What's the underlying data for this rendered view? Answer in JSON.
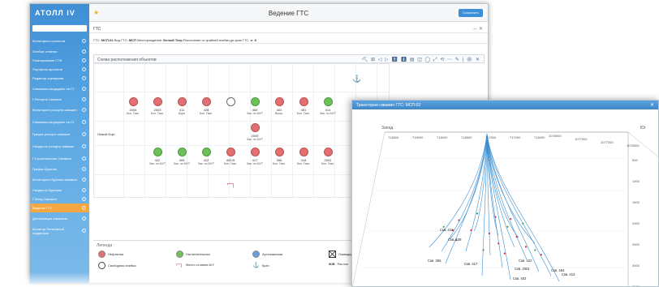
{
  "app": {
    "logo": "АТОЛЛ IV",
    "title": "Ведение ГТС",
    "save_label": "Сохранить",
    "star": "★"
  },
  "sidebar": {
    "items": [
      {
        "label": "Мониторинг проектов",
        "active": false
      },
      {
        "label": "Особые отметки",
        "active": false
      },
      {
        "label": "Планирование ГТМ",
        "active": false
      },
      {
        "label": "Портфель проектов",
        "active": false
      },
      {
        "label": "Редактор сценариев",
        "active": false
      },
      {
        "label": "Скважины-кандидаты на ГС",
        "active": false
      },
      {
        "label": "Г.Репорты Скважин",
        "active": false
      },
      {
        "label": "Мониторинг репорта скважин",
        "active": false
      },
      {
        "label": "Скважины-кандидаты на ГС",
        "active": false
      },
      {
        "label": "График репорта скважин",
        "active": false
      },
      {
        "label": "Сводка по репорту скважин",
        "active": false
      },
      {
        "label": "Г.Строительство Скважин",
        "active": false
      },
      {
        "label": "График бурения",
        "active": false
      },
      {
        "label": "Мониторинг бурения скважин",
        "active": false
      },
      {
        "label": "Сводка по бурению",
        "active": false
      },
      {
        "label": "Г.Фонд Скважин",
        "active": false
      },
      {
        "label": "Ведение ГТС",
        "active": true
      },
      {
        "label": "Детализация скважины",
        "active": false
      },
      {
        "label": "Монитор Негативной поддержки",
        "active": false
      }
    ]
  },
  "gts_bar": {
    "label": "ГТС",
    "icons": "⇔ ✕"
  },
  "info_line": {
    "gts_key": "ГТС:",
    "gts_val": "МСП-02",
    "type_key": "Вид ГТС:",
    "type_val": "МСП",
    "field_key": "Месторождение:",
    "field_val": "Белый Тигр",
    "dist_key": "Расстояние от крайней ячейки до края ГТС, м:",
    "dist_val": "8"
  },
  "panel": {
    "title": "Схема расположения объектов",
    "toolbar": "⛏ ⊞ ◁ ▷ ⬆ ⬇ ▤ ◫ ◯ ⤢ ⟲ ⋯ ✎ | ⚙ ✕"
  },
  "row_label": "Левый борт",
  "wells_top": [
    {
      "num": "2004",
      "type": "Кон. Газл.",
      "status": "red"
    },
    {
      "num": "2003",
      "type": "Кон. Газл.",
      "status": "red"
    },
    {
      "num": "411",
      "type": "Бурн",
      "status": "red"
    },
    {
      "num": "428",
      "type": "Кон. Газл.",
      "status": "red"
    },
    {
      "num": "",
      "type": "",
      "status": "empty"
    },
    {
      "num": "464",
      "type": "Зак. по МУТ",
      "status": "green"
    },
    {
      "num": "402",
      "type": "Воош.",
      "status": "red"
    },
    {
      "num": "451",
      "type": "Кон. Газл.",
      "status": "red"
    },
    {
      "num": "414",
      "type": "Зак. по МУТ",
      "status": "green"
    }
  ],
  "well_mid": {
    "num": "2005",
    "type": "Зак. по МУТ",
    "status": "red"
  },
  "wells_bottom": [
    {
      "num": "422",
      "type": "Зак. по МУТ",
      "status": "green"
    },
    {
      "num": "409",
      "type": "Зак. по МУТ",
      "status": "green"
    },
    {
      "num": "412",
      "type": "Зак. по МУТ",
      "status": "green"
    },
    {
      "num": "405 В",
      "type": "Кон. Газл.",
      "status": "red"
    },
    {
      "num": "417",
      "type": "Зак. по МУТ",
      "status": "red"
    },
    {
      "num": "356",
      "type": "Кон. Газл.",
      "status": "red"
    },
    {
      "num": "418",
      "type": "Кон. Газл.",
      "status": "red"
    },
    {
      "num": "2001",
      "type": "Кон. Газл.",
      "status": "red"
    }
  ],
  "legend": {
    "title": "Легенда",
    "oil": "Нефтяная",
    "injection": "Нагнетательная",
    "artesian": "Артезианская",
    "liquidated": "Ликвидир.",
    "free": "Свободная ячейка",
    "pump_place": "Место стояния Б/У",
    "crane": "Кран",
    "pipe_key": "Ж/Б",
    "pipe_label": "Раслоп"
  },
  "popup": {
    "title": "Траектории скважин ГТС: МСП-02",
    "close": "✕",
    "west": "Запад",
    "south": "Юг",
    "top_ticks": [
      "716500",
      "719000",
      "718000",
      "718500",
      "717500",
      "717000",
      "716000"
    ],
    "right_top_ticks": [
      "1078000",
      "1077500",
      "1077000",
      "1076500"
    ],
    "depth_ticks": [
      "500",
      "1000",
      "1500",
      "2000",
      "2500",
      "3000",
      "3500"
    ],
    "wells": [
      "Скв. 411",
      "Скв. 428",
      "Скв. 356",
      "Скв. 417",
      "Скв. 422",
      "Скв. 2001",
      "Скв. 464",
      "Скв. 414",
      "Скв. 402"
    ]
  },
  "colors": {
    "accent": "#3a8fd6",
    "active_nav": "#f4a640",
    "oil": "#e27070",
    "injection": "#6fc05a",
    "artesian": "#6d9ee0",
    "trajectory": "#3c8ed2"
  }
}
